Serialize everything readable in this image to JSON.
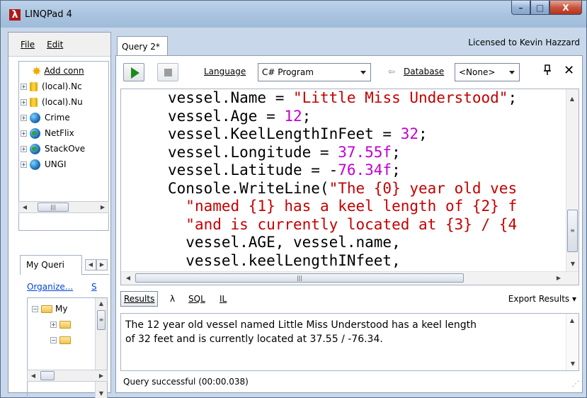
{
  "window": {
    "title": "LINQPad 4",
    "minimize": "–",
    "maximize": "□",
    "close": "X",
    "app_icon": "λ"
  },
  "menu": {
    "file": "File",
    "edit": "Edit"
  },
  "connections": {
    "items": [
      {
        "label": "Add conn",
        "icon": "add-connection-icon"
      },
      {
        "label": "(local).Nc",
        "icon": "database-icon"
      },
      {
        "label": "(local).Nu",
        "icon": "database-icon"
      },
      {
        "label": "Crime",
        "icon": "odata-globe-icon"
      },
      {
        "label": "NetFlix",
        "icon": "globe-icon"
      },
      {
        "label": "StackOve",
        "icon": "globe-icon"
      },
      {
        "label": "UNGI",
        "icon": "odata-globe-icon"
      }
    ]
  },
  "my_queries": {
    "tab_label": "My Queri",
    "organize": "Organize...",
    "organize_s": "S",
    "root": "My"
  },
  "query_tab": {
    "label": "Query 2*"
  },
  "license": "Licensed to Kevin Hazzard",
  "toolbar": {
    "language_label": "Language",
    "language_value": "C# Program",
    "database_label": "Database",
    "database_value": "<None>",
    "database_arrow": "⇦",
    "pin": "📌",
    "close": "✕"
  },
  "code_lines": [
    [
      {
        "t": "vessel.Name = ",
        "c": "plain"
      },
      {
        "t": "\"Little Miss Understood\"",
        "c": "str"
      },
      {
        "t": ";",
        "c": "plain"
      }
    ],
    [
      {
        "t": "vessel.Age = ",
        "c": "plain"
      },
      {
        "t": "12",
        "c": "num"
      },
      {
        "t": ";",
        "c": "plain"
      }
    ],
    [
      {
        "t": "vessel.KeelLengthInFeet = ",
        "c": "plain"
      },
      {
        "t": "32",
        "c": "num"
      },
      {
        "t": ";",
        "c": "plain"
      }
    ],
    [
      {
        "t": "vessel.Longitude = ",
        "c": "plain"
      },
      {
        "t": "37.55f",
        "c": "num"
      },
      {
        "t": ";",
        "c": "plain"
      }
    ],
    [
      {
        "t": "vessel.Latitude = -",
        "c": "plain"
      },
      {
        "t": "76.34f",
        "c": "num"
      },
      {
        "t": ";",
        "c": "plain"
      }
    ],
    [
      {
        "t": "Console.WriteLine(",
        "c": "plain"
      },
      {
        "t": "\"The {0} year old ves",
        "c": "str"
      }
    ],
    [
      {
        "t": "  ",
        "c": "plain"
      },
      {
        "t": "\"named {1} has a keel length of {2} f",
        "c": "str"
      }
    ],
    [
      {
        "t": "  ",
        "c": "plain"
      },
      {
        "t": "\"and is currently located at {3} / {4",
        "c": "str"
      }
    ],
    [
      {
        "t": "  vessel.AGE, vessel.name,",
        "c": "plain"
      }
    ],
    [
      {
        "t": "  vessel.keelLengthINfeet,",
        "c": "plain"
      }
    ]
  ],
  "results_tabs": {
    "results": "Results",
    "lambda": "λ",
    "sql": "SQL",
    "il": "IL",
    "export": "Export Results ▾"
  },
  "output": "The 12 year old vessel named Little Miss Understood has a keel length\nof 32 feet and is currently located at 37.55 / -76.34.",
  "status": "Query successful  (00:00.038)"
}
